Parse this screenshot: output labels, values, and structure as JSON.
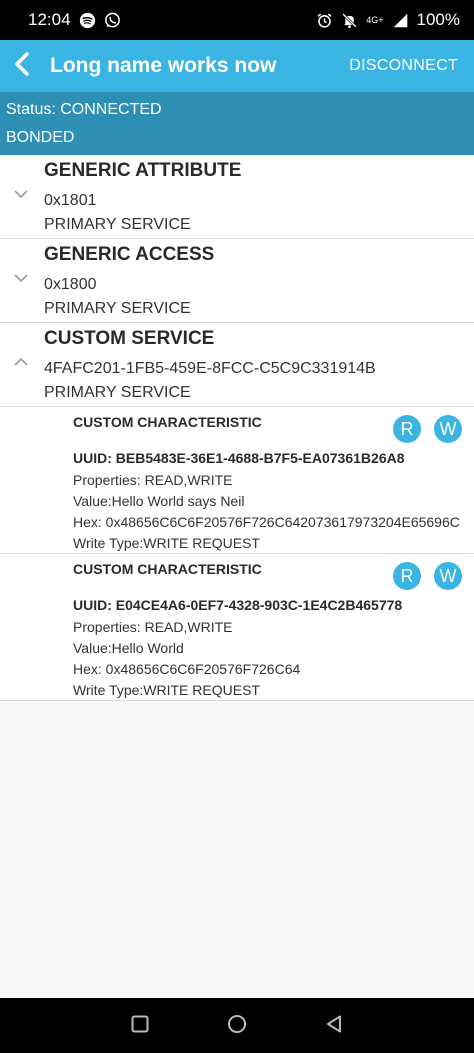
{
  "status_bar": {
    "time": "12:04",
    "network": "4G+",
    "battery": "100%",
    "icons": [
      "spotify-icon",
      "whatsapp-icon",
      "alarm-icon",
      "mute-icon",
      "signal-icon"
    ]
  },
  "app_bar": {
    "title": "Long name works now",
    "action": "DISCONNECT",
    "color": "#3ab5e3"
  },
  "status_panel": {
    "status": "Status: CONNECTED",
    "bond": "BONDED",
    "color": "#2e8fb5"
  },
  "services": [
    {
      "name": "GENERIC ATTRIBUTE",
      "uuid": "0x1801",
      "type": "PRIMARY SERVICE",
      "expanded": false
    },
    {
      "name": "GENERIC ACCESS",
      "uuid": "0x1800",
      "type": "PRIMARY SERVICE",
      "expanded": false
    },
    {
      "name": "CUSTOM SERVICE",
      "uuid": "4FAFC201-1FB5-459E-8FCC-C5C9C331914B",
      "type": "PRIMARY SERVICE",
      "expanded": true
    }
  ],
  "characteristics": [
    {
      "name": "CUSTOM CHARACTERISTIC",
      "uuid": "UUID: BEB5483E-36E1-4688-B7F5-EA07361B26A8",
      "properties": "Properties: READ,WRITE",
      "value": "Value:Hello World says Neil",
      "hex": "Hex: 0x48656C6C6F20576F726C642073617973204E65696C",
      "write_type": "Write Type:WRITE REQUEST",
      "read_label": "R",
      "write_label": "W"
    },
    {
      "name": "CUSTOM CHARACTERISTIC",
      "uuid": "UUID: E04CE4A6-0EF7-4328-903C-1E4C2B465778",
      "properties": "Properties: READ,WRITE",
      "value": "Value:Hello World",
      "hex": "Hex: 0x48656C6C6F20576F726C64",
      "write_type": "Write Type:WRITE REQUEST",
      "read_label": "R",
      "write_label": "W"
    }
  ]
}
